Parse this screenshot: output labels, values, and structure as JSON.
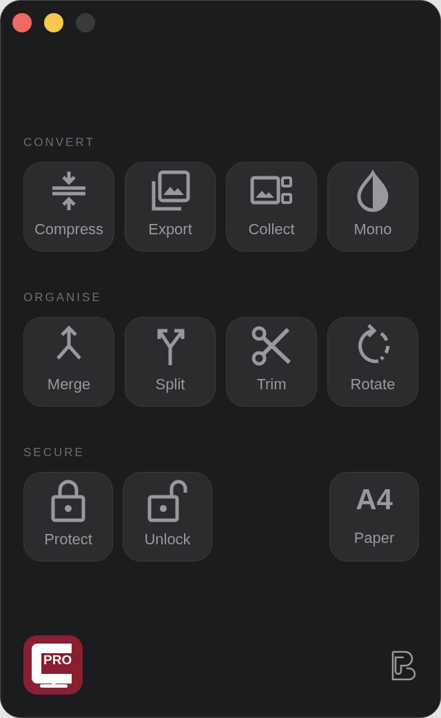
{
  "window": {
    "controls": [
      {
        "kind": "close",
        "disabled": false
      },
      {
        "kind": "minimize",
        "disabled": false
      },
      {
        "kind": "zoom",
        "disabled": true
      }
    ]
  },
  "sections": [
    {
      "title": "CONVERT",
      "buttons": [
        {
          "kind": "icon",
          "label": "Compress"
        },
        {
          "kind": "icon",
          "label": "Export"
        },
        {
          "kind": "icon",
          "label": "Collect"
        },
        {
          "kind": "icon",
          "label": "Mono"
        }
      ]
    },
    {
      "title": "ORGANISE",
      "buttons": [
        {
          "kind": "icon",
          "label": "Merge"
        },
        {
          "kind": "icon",
          "label": "Split"
        },
        {
          "kind": "icon",
          "label": "Trim"
        },
        {
          "kind": "icon",
          "label": "Rotate"
        }
      ]
    },
    {
      "title": "SECURE",
      "buttons": [
        {
          "kind": "icon",
          "label": "Protect"
        },
        {
          "kind": "icon",
          "label": "Unlock"
        },
        {
          "kind": "text",
          "glyph": "A4",
          "label": "Paper"
        }
      ]
    }
  ],
  "footer": {
    "app_logo_text": "PRO"
  }
}
